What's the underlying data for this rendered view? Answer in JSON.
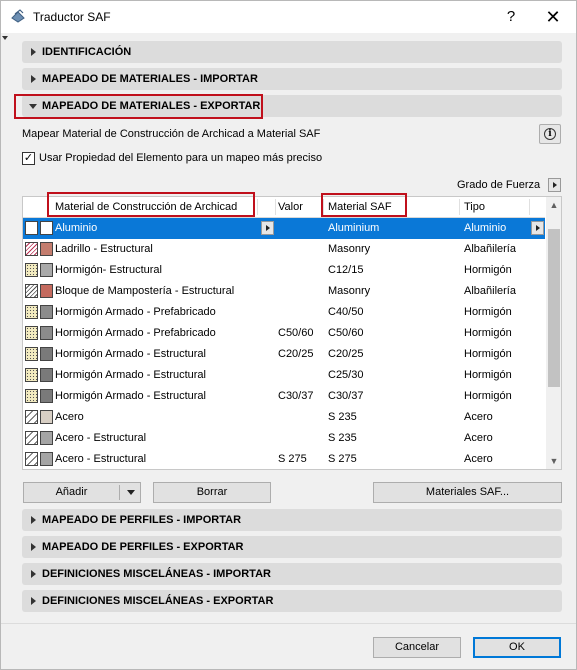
{
  "window": {
    "title": "Traductor SAF",
    "help_label": "?",
    "close_label": "✕"
  },
  "sections": {
    "identificacion": "IDENTIFICACIÓN",
    "mat_importar": "MAPEADO DE MATERIALES - IMPORTAR",
    "mat_exportar": "MAPEADO DE MATERIALES - EXPORTAR",
    "perf_importar": "MAPEADO DE PERFILES - IMPORTAR",
    "perf_exportar": "MAPEADO DE PERFILES - EXPORTAR",
    "misc_importar": "DEFINICIONES MISCELÁNEAS - IMPORTAR",
    "misc_exportar": "DEFINICIONES MISCELÁNEAS - EXPORTAR"
  },
  "export_panel": {
    "description": "Mapear Material de Construcción de Archicad a Material SAF",
    "info_icon_label": "i",
    "checkbox_label": "Usar Propiedad del Elemento para un mapeo más preciso",
    "checkbox_checked": true,
    "checkmark": "✓",
    "strength_label": "Grado de Fuerza"
  },
  "table": {
    "headers": {
      "material": "Material de Construcción de Archicad",
      "value": "Valor",
      "saf": "Material SAF",
      "type": "Tipo"
    },
    "rows": [
      {
        "material": "Aluminio",
        "value": "",
        "saf": "Aluminium",
        "type": "Aluminio",
        "pattern": "blank",
        "color": "#ffffff",
        "selected": true
      },
      {
        "material": "Ladrillo - Estructural",
        "value": "",
        "saf": "Masonry",
        "type": "Albañilería",
        "pattern": "hatch-red",
        "color": "#c47d6e",
        "selected": false
      },
      {
        "material": "Hormigón- Estructural",
        "value": "",
        "saf": "C12/15",
        "type": "Hormigón",
        "pattern": "dots",
        "color": "#a9a9a9",
        "selected": false
      },
      {
        "material": "Bloque de Mampostería - Estructural",
        "value": "",
        "saf": "Masonry",
        "type": "Albañilería",
        "pattern": "hatch",
        "color": "#c46a5e",
        "selected": false
      },
      {
        "material": "Hormigón Armado - Prefabricado",
        "value": "",
        "saf": "C40/50",
        "type": "Hormigón",
        "pattern": "dots",
        "color": "#8c8c8c",
        "selected": false
      },
      {
        "material": "Hormigón Armado - Prefabricado",
        "value": "C50/60",
        "saf": "C50/60",
        "type": "Hormigón",
        "pattern": "dots",
        "color": "#8c8c8c",
        "selected": false
      },
      {
        "material": "Hormigón Armado - Estructural",
        "value": "C20/25",
        "saf": "C20/25",
        "type": "Hormigón",
        "pattern": "dots",
        "color": "#7a7a7a",
        "selected": false
      },
      {
        "material": "Hormigón Armado - Estructural",
        "value": "",
        "saf": "C25/30",
        "type": "Hormigón",
        "pattern": "dots",
        "color": "#7a7a7a",
        "selected": false
      },
      {
        "material": "Hormigón Armado - Estructural",
        "value": "C30/37",
        "saf": "C30/37",
        "type": "Hormigón",
        "pattern": "dots",
        "color": "#7a7a7a",
        "selected": false
      },
      {
        "material": "Acero",
        "value": "",
        "saf": "S 235",
        "type": "Acero",
        "pattern": "steel",
        "color": "#d8cfc4",
        "selected": false
      },
      {
        "material": "Acero - Estructural",
        "value": "",
        "saf": "S 235",
        "type": "Acero",
        "pattern": "steel",
        "color": "#a5a5a5",
        "selected": false
      },
      {
        "material": "Acero - Estructural",
        "value": "S 275",
        "saf": "S 275",
        "type": "Acero",
        "pattern": "steel",
        "color": "#a5a5a5",
        "selected": false
      }
    ]
  },
  "buttons": {
    "add": "Añadir",
    "delete": "Borrar",
    "saf_materials": "Materiales SAF...",
    "cancel": "Cancelar",
    "ok": "OK"
  },
  "colors": {
    "selection": "#0a78d7",
    "highlight_box": "#c0101c",
    "section_bar": "#dcdcdc"
  }
}
